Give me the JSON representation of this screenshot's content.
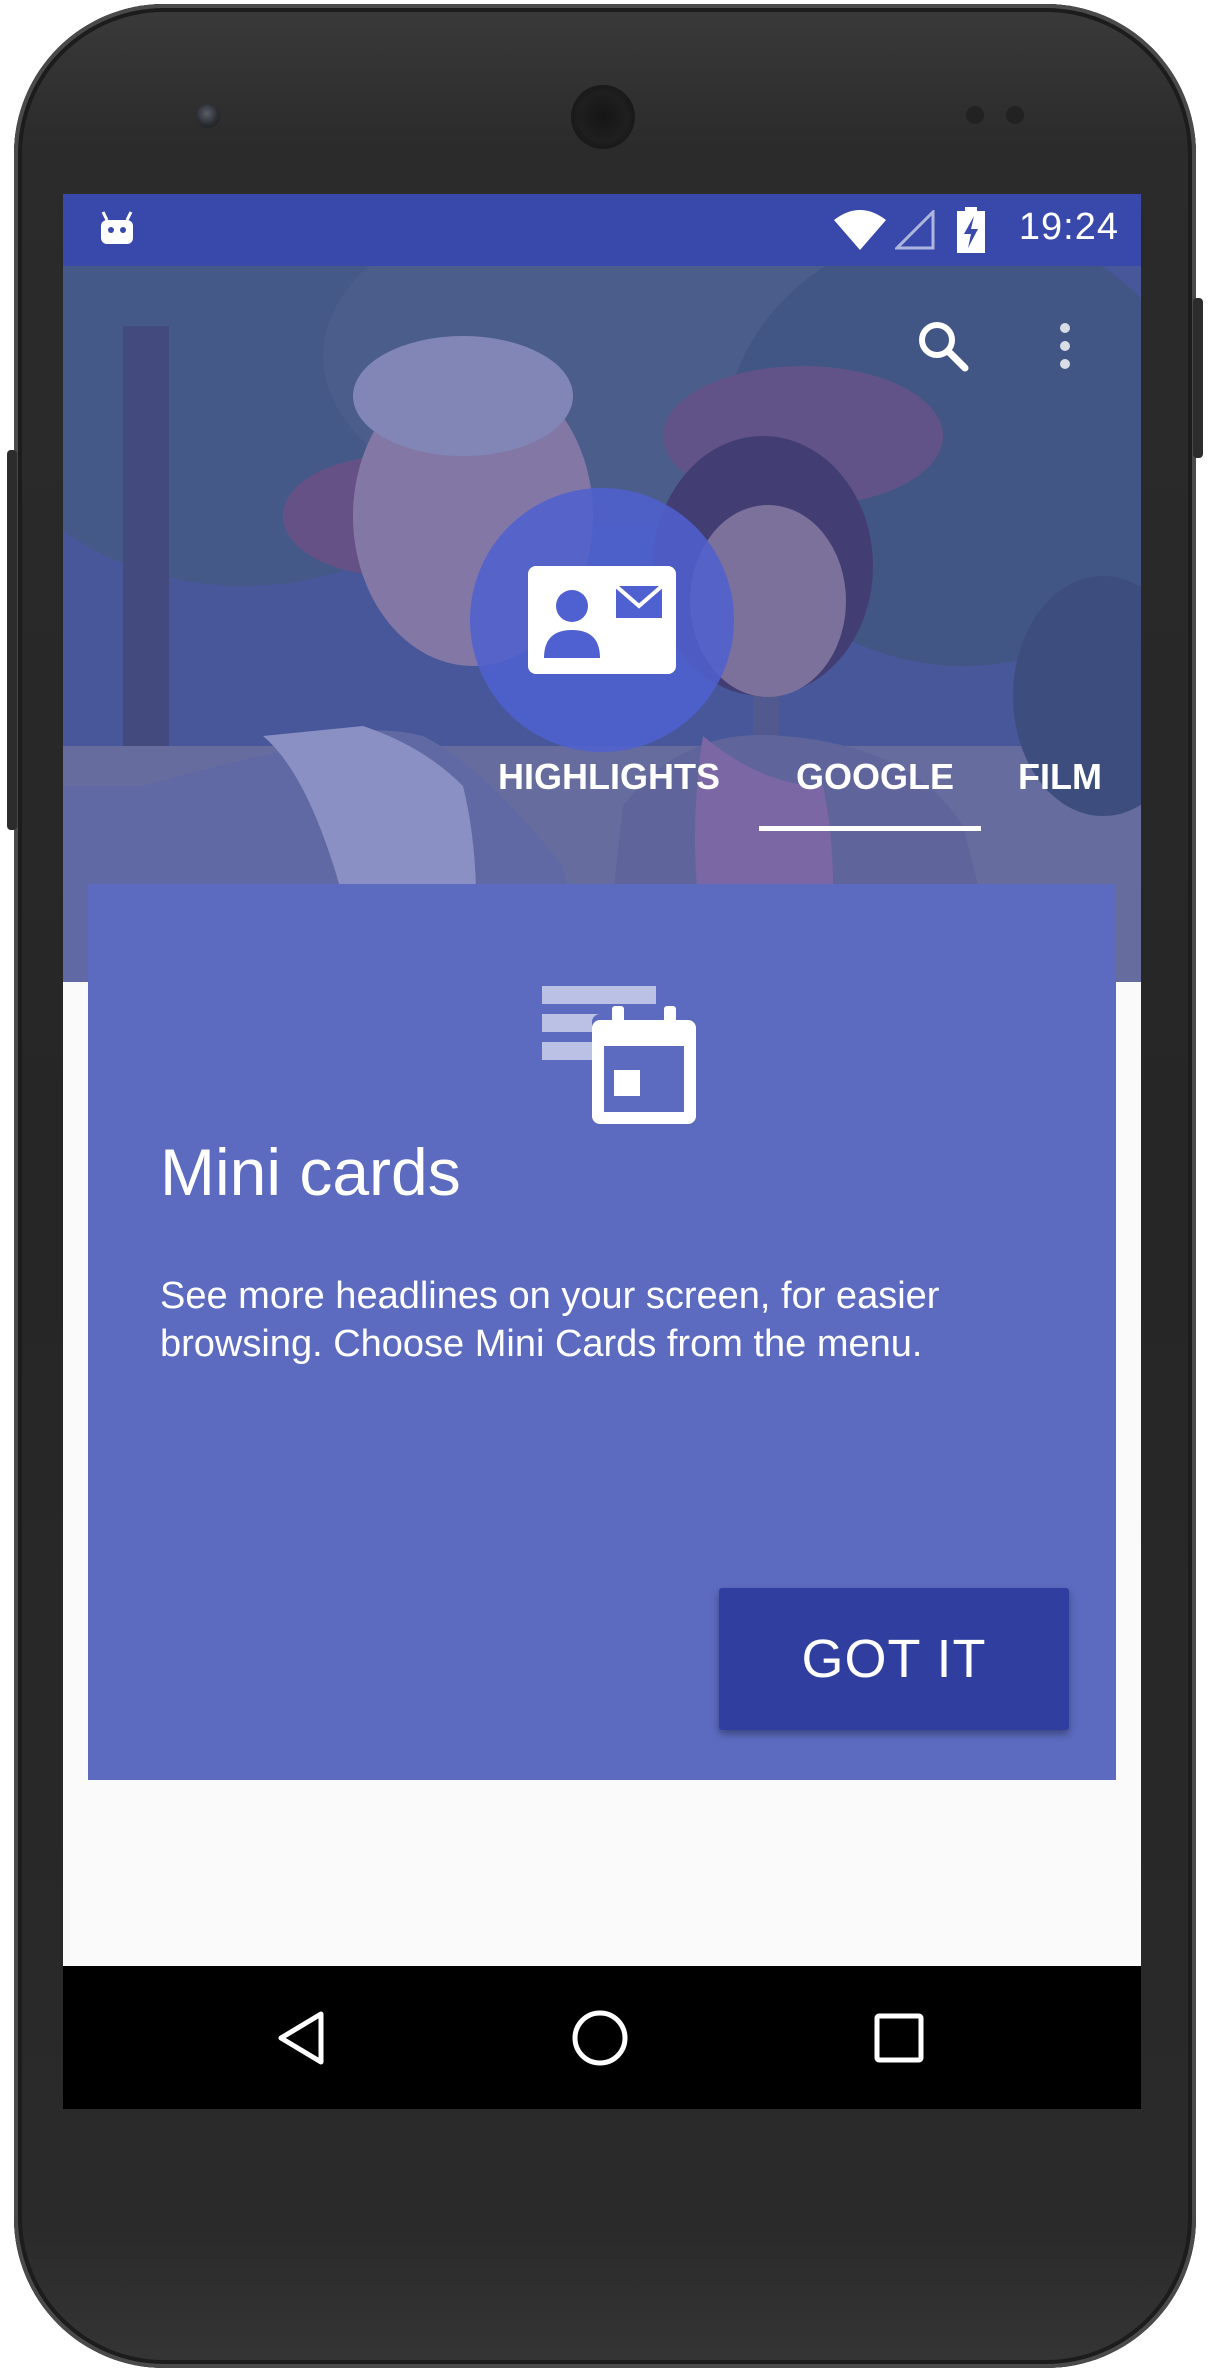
{
  "status_bar": {
    "time": "19:24",
    "notification_icon": "android-debug-icon",
    "wifi_icon": "wifi-icon",
    "signal_icon": "cell-signal-empty-icon",
    "battery_icon": "battery-charging-icon",
    "color": "#3949ab"
  },
  "toolbar": {
    "search_icon": "search-icon",
    "overflow_icon": "more-vert-icon",
    "section_icon": "contact-card-icon"
  },
  "tabs": [
    {
      "label": "HIGHLIGHTS",
      "selected": false
    },
    {
      "label": "GOOGLE",
      "selected": true
    },
    {
      "label": "FILM",
      "selected": false
    }
  ],
  "tutorial_card": {
    "icon": "mini-cards-calendar-icon",
    "title": "Mini cards",
    "body": "See more headlines on your screen, for easier browsing. Choose Mini Cards from the menu.",
    "button_label": "GOT IT",
    "card_color": "#5c6bc0",
    "button_color": "#303f9f"
  },
  "nav_bar": {
    "back_icon": "back-icon",
    "home_icon": "home-icon",
    "recents_icon": "recents-icon"
  }
}
